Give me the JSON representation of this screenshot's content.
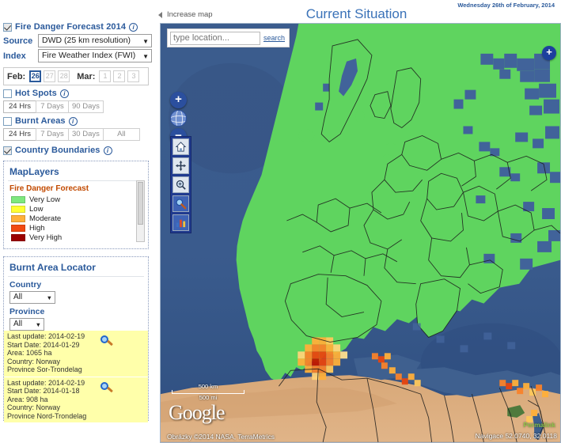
{
  "header": {
    "increase_map": "Increase map",
    "title": "Current Situation",
    "date_stamp": "Wednesday 26th of February, 2014"
  },
  "sidebar": {
    "forecast": {
      "label": "Fire Danger Forecast 2014",
      "checked": true,
      "source_label": "Source",
      "source_value": "DWD (25 km resolution)",
      "index_label": "Index",
      "index_value": "Fire Weather Index (FWI)",
      "month1_label": "Feb:",
      "month1_days": [
        "26",
        "27",
        "28"
      ],
      "month1_active": "26",
      "month2_label": "Mar:",
      "month2_days": [
        "1",
        "2",
        "3"
      ]
    },
    "hotspots": {
      "label": "Hot Spots",
      "checked": false,
      "buttons": [
        "24 Hrs",
        "7 Days",
        "90 Days"
      ],
      "active": "24 Hrs"
    },
    "burnt_areas": {
      "label": "Burnt Areas",
      "checked": false,
      "buttons": [
        "24 Hrs",
        "7 Days",
        "30 Days",
        "All"
      ],
      "active": "24 Hrs"
    },
    "country_boundaries": {
      "label": "Country Boundaries",
      "checked": true
    },
    "maplayers": {
      "title": "MapLayers",
      "legend_title": "Fire Danger Forecast",
      "legend": [
        {
          "label": "Very Low",
          "color": "#7ee87e"
        },
        {
          "label": "Low",
          "color": "#ffff33"
        },
        {
          "label": "Moderate",
          "color": "#ffb03a"
        },
        {
          "label": "High",
          "color": "#f14a12"
        },
        {
          "label": "Very High",
          "color": "#9c0000"
        }
      ]
    },
    "locator": {
      "title": "Burnt Area Locator",
      "country_label": "Country",
      "country_value": "All",
      "province_label": "Province",
      "province_value": "All",
      "results": [
        {
          "last_update": "Last update: 2014-02-19",
          "start_date": "Start Date: 2014-01-29",
          "area": "Area: 1065 ha",
          "country": "Country: Norway",
          "province": "Province Sor-Trondelag"
        },
        {
          "last_update": "Last update: 2014-02-19",
          "start_date": "Start Date: 2014-01-18",
          "area": "Area: 908 ha",
          "country": "Country: Norway",
          "province": "Province Nord-Trondelag"
        }
      ]
    }
  },
  "map": {
    "search_placeholder": "type location...",
    "search_value": "",
    "search_button": "search",
    "zoom_in": "+",
    "zoom_out": "−",
    "plus_button": "+",
    "scale_km": "500 km",
    "scale_mi": "500 mi",
    "google_logo": "Google",
    "attribution": "Obrázky ©2014 NASA, TerraMetrics",
    "permalink": "Permalink",
    "coords": "Navigace 52.0740, 32.0118",
    "tools": [
      "home-icon",
      "pan-icon",
      "zoom-area-icon",
      "info-query-icon",
      "chart-icon"
    ]
  }
}
